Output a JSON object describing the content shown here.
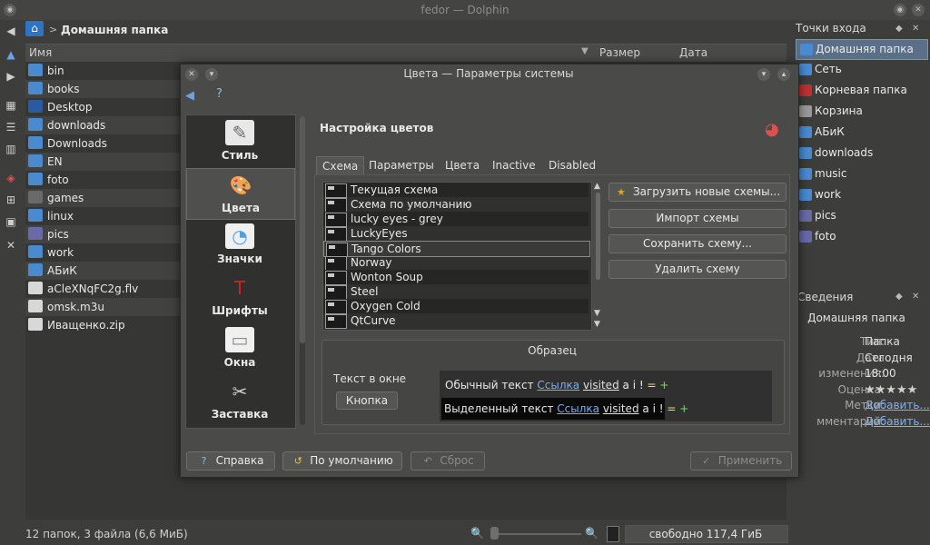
{
  "window": {
    "title": "fedor — Dolphin",
    "min_glyph": "◉",
    "close_glyph": "✕"
  },
  "location": {
    "crumb": "Домашняя папка",
    "sep": ">"
  },
  "columns": {
    "name": "Имя",
    "size": "Размер",
    "date": "Дата",
    "sort_glyph": "▼"
  },
  "files": [
    {
      "name": "bin",
      "color": "#4a8ad0"
    },
    {
      "name": "books",
      "color": "#4a8ad0"
    },
    {
      "name": "Desktop",
      "color": "#2a5aa0"
    },
    {
      "name": "downloads",
      "color": "#4a8ad0"
    },
    {
      "name": "Downloads",
      "color": "#4a8ad0"
    },
    {
      "name": "EN",
      "color": "#4a8ad0"
    },
    {
      "name": "foto",
      "color": "#4a8ad0"
    },
    {
      "name": "games",
      "color": "#6a6a6a"
    },
    {
      "name": "linux",
      "color": "#4a8ad0"
    },
    {
      "name": "pics",
      "color": "#6a6aa8"
    },
    {
      "name": "work",
      "color": "#4a8ad0"
    },
    {
      "name": "АБиК",
      "color": "#4a8ad0"
    },
    {
      "name": "aCleXNqFC2g.flv",
      "color": "#d8d8d8"
    },
    {
      "name": "omsk.m3u",
      "color": "#d8d8d8"
    },
    {
      "name": "Иващенко.zip",
      "color": "#d8d8d8"
    }
  ],
  "status": {
    "summary": "12 папок, 3 файла (6,6 МиБ)",
    "free": "свободно 117,4 ГиБ",
    "zoom_glyph": "🔍"
  },
  "places": {
    "title": "Точки входа",
    "items": [
      {
        "label": "Домашняя папка",
        "color": "#4a8ad0",
        "selected": true
      },
      {
        "label": "Сеть",
        "color": "#4a8ad0"
      },
      {
        "label": "Корневая папка",
        "color": "#c03030"
      },
      {
        "label": "Корзина",
        "color": "#9a9a9a"
      },
      {
        "label": "АБиК",
        "color": "#4a8ad0"
      },
      {
        "label": "downloads",
        "color": "#4a8ad0"
      },
      {
        "label": "music",
        "color": "#4a8ad0"
      },
      {
        "label": "work",
        "color": "#4a8ad0"
      },
      {
        "label": "pics",
        "color": "#6a6aa8"
      },
      {
        "label": "foto",
        "color": "#6a6aa8"
      }
    ]
  },
  "info": {
    "title": "Сведения",
    "heading": "Домашняя папка",
    "rows": [
      {
        "key": "Тип:",
        "value": "Папка"
      },
      {
        "key": "Дата",
        "value": "Сегодня"
      },
      {
        "key": "изменения:",
        "value": "18:00"
      },
      {
        "key": "Оценка:",
        "value": "★★★★★"
      },
      {
        "key": "Метки:",
        "value": "Добавить...",
        "link": true
      },
      {
        "key": "мментарий:",
        "value": "Добавить...",
        "link": true
      }
    ]
  },
  "dialog": {
    "title": "Цвета — Параметры системы",
    "section_title": "Настройка цветов",
    "categories": [
      {
        "label": "Стиль",
        "glyph": "✎",
        "bg": "#e8e8e8",
        "fg": "#6a6a6a"
      },
      {
        "label": "Цвета",
        "glyph": "🎨",
        "bg": "transparent",
        "fg": "#e05050",
        "selected": true
      },
      {
        "label": "Значки",
        "glyph": "◔",
        "bg": "#f0f0f0",
        "fg": "#50a0e0"
      },
      {
        "label": "Шрифты",
        "glyph": "T",
        "bg": "transparent",
        "fg": "#d02020"
      },
      {
        "label": "Окна",
        "glyph": "▭",
        "bg": "#f0f0f0",
        "fg": "#8a8a8a"
      },
      {
        "label": "Заставка",
        "glyph": "✂",
        "bg": "transparent",
        "fg": "#d0d0d0"
      }
    ],
    "tabs": [
      {
        "label": "Схема",
        "selected": true
      },
      {
        "label": "Параметры"
      },
      {
        "label": "Цвета"
      },
      {
        "label": "Inactive"
      },
      {
        "label": "Disabled"
      }
    ],
    "schemes": [
      "Текущая схема",
      "Схема по умолчанию",
      "lucky eyes - grey",
      "LuckyEyes",
      "Tango Colors",
      "Norway",
      "Wonton Soup",
      "Steel",
      "Oxygen Cold",
      "QtCurve"
    ],
    "selected_scheme": 4,
    "side_buttons": [
      {
        "label": "Загрузить новые схемы...",
        "icon": "★"
      },
      {
        "label": "Импорт схемы"
      },
      {
        "label": "Сохранить схему..."
      },
      {
        "label": "Удалить схему"
      }
    ],
    "sample": {
      "title": "Образец",
      "text_label": "Текст в окне",
      "button_label": "Кнопка",
      "normal_text": "Обычный текст",
      "selected_text": "Выделенный текст",
      "link": "Ссылка",
      "visited": "visited",
      "a": "a",
      "i": "i",
      "excl": "!",
      "eq": "=",
      "plus": "+"
    },
    "buttons": {
      "help": "Справка",
      "defaults": "По умолчанию",
      "reset": "Сброс",
      "apply": "Применить"
    }
  }
}
